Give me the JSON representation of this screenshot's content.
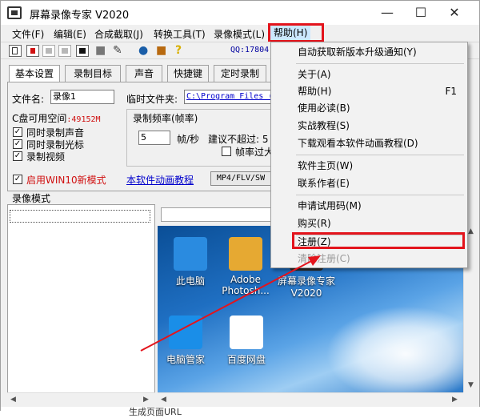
{
  "window": {
    "title": "屏幕录像专家 V2020",
    "minimize": "—",
    "maximize": "☐",
    "close": "✕"
  },
  "menubar": [
    {
      "label": "文件(F)"
    },
    {
      "label": "编辑(E)"
    },
    {
      "label": "合成截取(J)"
    },
    {
      "label": "转换工具(T)"
    },
    {
      "label": "录像模式(L)"
    },
    {
      "label": "帮助(H)"
    }
  ],
  "toolbar": {
    "icons": [
      "record-icon",
      "stop-icon",
      "pause-icon",
      "playback-icon",
      "camera-icon",
      "pen-icon",
      "globe-icon",
      "briefcase-icon",
      "help-icon"
    ],
    "qq": "QQ:17804"
  },
  "tabs": [
    "基本设置",
    "录制目标",
    "声音",
    "快捷键",
    "定时录制"
  ],
  "basic": {
    "filename_label": "文件名:",
    "filename_value": "录像1",
    "tempdir_label": "临时文件夹:",
    "tempdir_value": "C:\\Program Files (",
    "disk_label": "C盘可用空间",
    "disk_value": ":49152M",
    "cb_sound": "同时录制声音",
    "cb_cursor": "同时录制光标",
    "cb_video": "录制视频",
    "cb_win10": "启用WIN10新模式",
    "freq_group": "录制频率(帧率)",
    "fps_value": "5",
    "fps_unit": "帧/秒",
    "suggest": "建议不超过: 5",
    "fps_high": "帧率过大",
    "tutorial_link": "本软件动画教程",
    "format_button": "MP4/FLV/SW"
  },
  "record_mode_label": "录像模式",
  "desktop": {
    "icons": [
      {
        "label": "此电脑",
        "icon": "computer-icon"
      },
      {
        "label": "Adobe Photosh...",
        "icon": "photoshop-icon"
      },
      {
        "label": "屏幕录像专家 V2020",
        "icon": "recorder-icon"
      },
      {
        "label": "电脑管家",
        "icon": "shield-icon"
      },
      {
        "label": "百度网盘",
        "icon": "cloud-icon"
      }
    ]
  },
  "help_menu": {
    "items": [
      {
        "label": "自动获取新版本升级通知(Y)",
        "shortcut": "",
        "disabled": false
      },
      {
        "label": "关于(A)",
        "shortcut": "",
        "disabled": false
      },
      {
        "label": "帮助(H)",
        "shortcut": "F1",
        "disabled": false
      },
      {
        "label": "使用必读(B)",
        "shortcut": "",
        "disabled": false
      },
      {
        "label": "实战教程(S)",
        "shortcut": "",
        "disabled": false
      },
      {
        "label": "下载观看本软件动画教程(D)",
        "shortcut": "",
        "disabled": false
      },
      {
        "label": "软件主页(W)",
        "shortcut": "",
        "disabled": false
      },
      {
        "label": "联系作者(E)",
        "shortcut": "",
        "disabled": false
      },
      {
        "label": "申请试用码(M)",
        "shortcut": "",
        "disabled": false
      },
      {
        "label": "购买(R)",
        "shortcut": "",
        "disabled": false
      },
      {
        "label": "注册(Z)",
        "shortcut": "",
        "disabled": false
      },
      {
        "label": "清除注册(C)",
        "shortcut": "",
        "disabled": true
      }
    ]
  },
  "bottom_text": "生成页面URL",
  "colors": {
    "highlight": "#e3141c",
    "link": "#0000cc",
    "accent_text": "#d01010"
  }
}
